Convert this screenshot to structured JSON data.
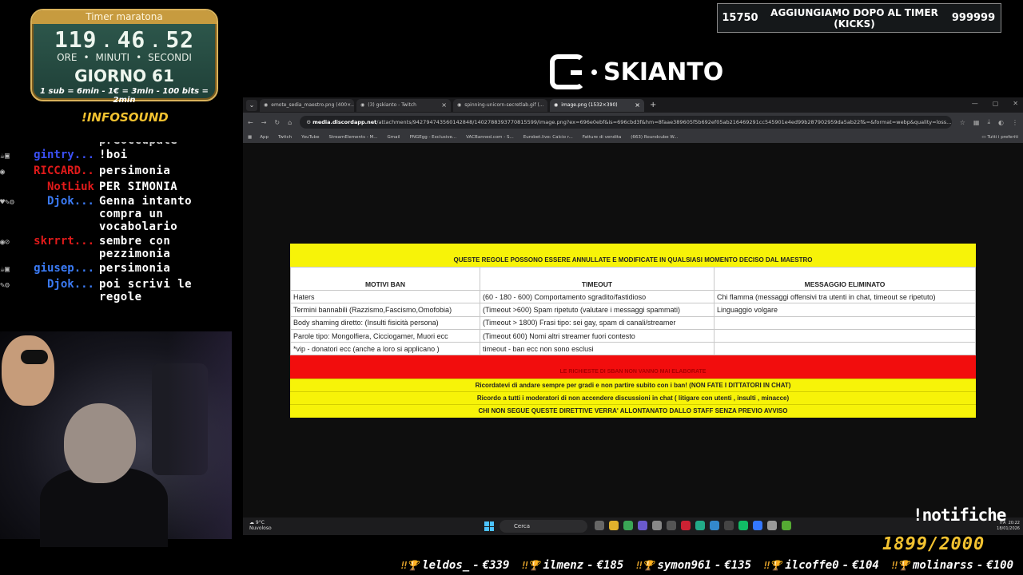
{
  "timer": {
    "title": "Timer maratona",
    "hours": "119",
    "minutes": "46",
    "seconds": "52",
    "sep": ".",
    "unit_hours": "ORE",
    "unit_minutes": "MINUTI",
    "unit_seconds": "SECONDI",
    "unit_sep": "•",
    "day": "GIORNO 61",
    "rule": "1 sub = 6min - 1€ = 3min - 100 bits = 2min"
  },
  "infosound": "!INFOSOUND",
  "chat": [
    {
      "badges": "☕▣",
      "user": "gintry...",
      "color": "#3b50f5",
      "msg": "!boi"
    },
    {
      "badges": "◉",
      "user": "RICCARD...",
      "color": "#e01a1a",
      "msg": "persimonia"
    },
    {
      "badges": "",
      "user": "NotLiuk",
      "color": "#e01a1a",
      "msg": "PER SIMONIA"
    },
    {
      "badges": "♥✎⚙",
      "user": "Djok...",
      "color": "#3b7bf5",
      "msg": "Genna intanto compra un vocabolario"
    },
    {
      "badges": "◉⊘",
      "user": "skrrrt...",
      "color": "#e01a1a",
      "msg": "sembre con pezzimonia"
    },
    {
      "badges": "☕▣",
      "user": "giusep...",
      "color": "#3b7bf5",
      "msg": "persimonia"
    },
    {
      "badges": "✎⚙",
      "user": "Djok...",
      "color": "#3b7bf5",
      "msg": "poi scrivi le regole"
    }
  ],
  "chat_partial": "preoccupate",
  "kicks": {
    "left": "15750",
    "title": "AGGIUNGIAMO DOPO AL TIMER (KICKS)",
    "right": "999999"
  },
  "logo": "SKIANTO",
  "browser": {
    "tabs": [
      {
        "label": "emote_sedia_maestro.png (400×...",
        "active": false
      },
      {
        "label": "(3) gskianto - Twitch",
        "active": false
      },
      {
        "label": "spinning-unicorn-secretlab.gif (...",
        "active": false
      },
      {
        "label": "image.png (1532×390)",
        "active": true
      }
    ],
    "new_tab": "+",
    "url_host": "media.discordapp.net",
    "url_path": "/attachments/942794743560142848/1402788393770815599/image.png?ex=696e0ebf&is=696cbd3f&hm=8faae389605f5b692ef05ab216469291cc545901e4ed99b287902959da5ab22f&=&format=webp&quality=loss...",
    "bookmarks": [
      "App",
      "Twitch",
      "YouTube",
      "StreamElements - M...",
      "Gmail",
      "PNGEgg - Exclusive...",
      "VACBanned.com - S...",
      "Eurobet.live: Calcio r...",
      "Fatture di vendita",
      "(663) Roundcube W..."
    ],
    "bookmarks_right": "Tutti i preferiti"
  },
  "rules": {
    "top_banner": "QUESTE REGOLE POSSONO ESSERE ANNULLATE E MODIFICATE IN QUALSIASI MOMENTO DECISO DAL MAESTRO",
    "headers": [
      "MOTIVI BAN",
      "TIMEOUT",
      "MESSAGGIO ELIMINATO"
    ],
    "rows": [
      [
        "Haters",
        "(60 - 180 - 600) Comportamento sgradito/fastidioso",
        "Chi flamma (messaggi offensivi tra utenti in chat, timeout se ripetuto)"
      ],
      [
        "Termini bannabili (Razzismo,Fascismo,Omofobia)",
        "(Timeout >600) Spam ripetuto (valutare i messaggi spammati)",
        "Linguaggio volgare"
      ],
      [
        "Body shaming diretto: (Insulti fisicità persona)",
        "(Timeout > 1800) Frasi tipo: sei gay, spam di canali/streamer",
        ""
      ],
      [
        "Parole tipo: Mongolfiera, Cicciogamer, Muori ecc",
        "(Timeout 600) Nomi altri streamer fuori contesto",
        ""
      ],
      [
        "*vip - donatori ecc (anche a loro si applicano )",
        "timeout - ban ecc non sono esclusi",
        ""
      ]
    ],
    "red_banner": "LE RICHIESTE DI SBAN NON VANNO MAI ELABORATE",
    "notes": [
      "Ricordatevi di andare sempre per gradi e non partire subito con i ban! (NON FATE I DITTATORI IN CHAT)",
      "Ricordo a tutti i moderatori di non accendere discussioni in chat ( litigare con utenti , insulti , minacce)",
      "CHI NON SEGUE QUESTE DIRETTIVE VERRA' ALLONTANATO DALLO STAFF SENZA PREVIO AVVISO"
    ]
  },
  "taskbar": {
    "weather_temp": "9°C",
    "weather_desc": "Nuvoloso",
    "search": "Cerca",
    "lang": "ITA",
    "time": "20:22",
    "date": "18/01/2026"
  },
  "notifiche": "!notifiche",
  "counter": "1899/2000",
  "ticker": [
    {
      "name": "leldos_",
      "amount": "€339"
    },
    {
      "name": "ilmenz",
      "amount": "€185"
    },
    {
      "name": "symon961",
      "amount": "€135"
    },
    {
      "name": "ilcoffe0",
      "amount": "€104"
    },
    {
      "name": "molinarss",
      "amount": "€100"
    }
  ],
  "ticker_sep": " - ",
  "ticker_trophy": "‼🏆",
  "colors": {
    "gold": "#f2c230",
    "timer_bg": "#2f5a4e",
    "rules_yellow": "#f7f308",
    "rules_red": "#f20d0d"
  }
}
